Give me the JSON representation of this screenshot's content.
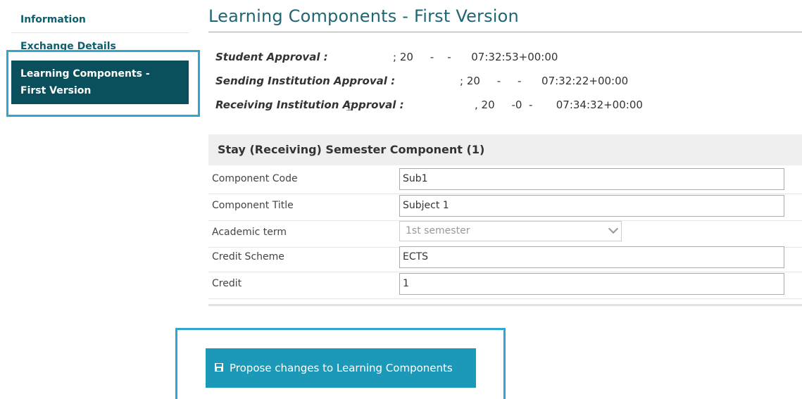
{
  "sidebar": {
    "items": [
      {
        "label": "Information"
      },
      {
        "label": "Exchange Details"
      },
      {
        "label_line1": "Learning Components -",
        "label_line2": "First Version"
      }
    ]
  },
  "main": {
    "title": "Learning Components - First Version",
    "approvals": [
      {
        "label": "Student Approval :",
        "value": "; 20     -    -      07:32:53+00:00"
      },
      {
        "label": "Sending Institution Approval :",
        "value": "; 20     -     -      07:32:22+00:00"
      },
      {
        "label": "Receiving Institution Approval :",
        "value": ", 20     -0  -       07:34:32+00:00"
      }
    ],
    "component": {
      "header": "Stay (Receiving) Semester Component (1)",
      "fields": [
        {
          "label": "Component Code",
          "value": "Sub1"
        },
        {
          "label": "Component Title",
          "value": "Subject 1"
        },
        {
          "label": "Academic term",
          "value": "1st semester"
        },
        {
          "label": "Credit Scheme",
          "value": "ECTS"
        },
        {
          "label": "Credit",
          "value": "1"
        }
      ]
    },
    "propose_button": "Propose changes to Learning Components"
  },
  "colors": {
    "accent": "#1c98b8",
    "active_nav": "#0a4f5c",
    "highlight": "#2fa6cf",
    "title": "#1f6674"
  }
}
